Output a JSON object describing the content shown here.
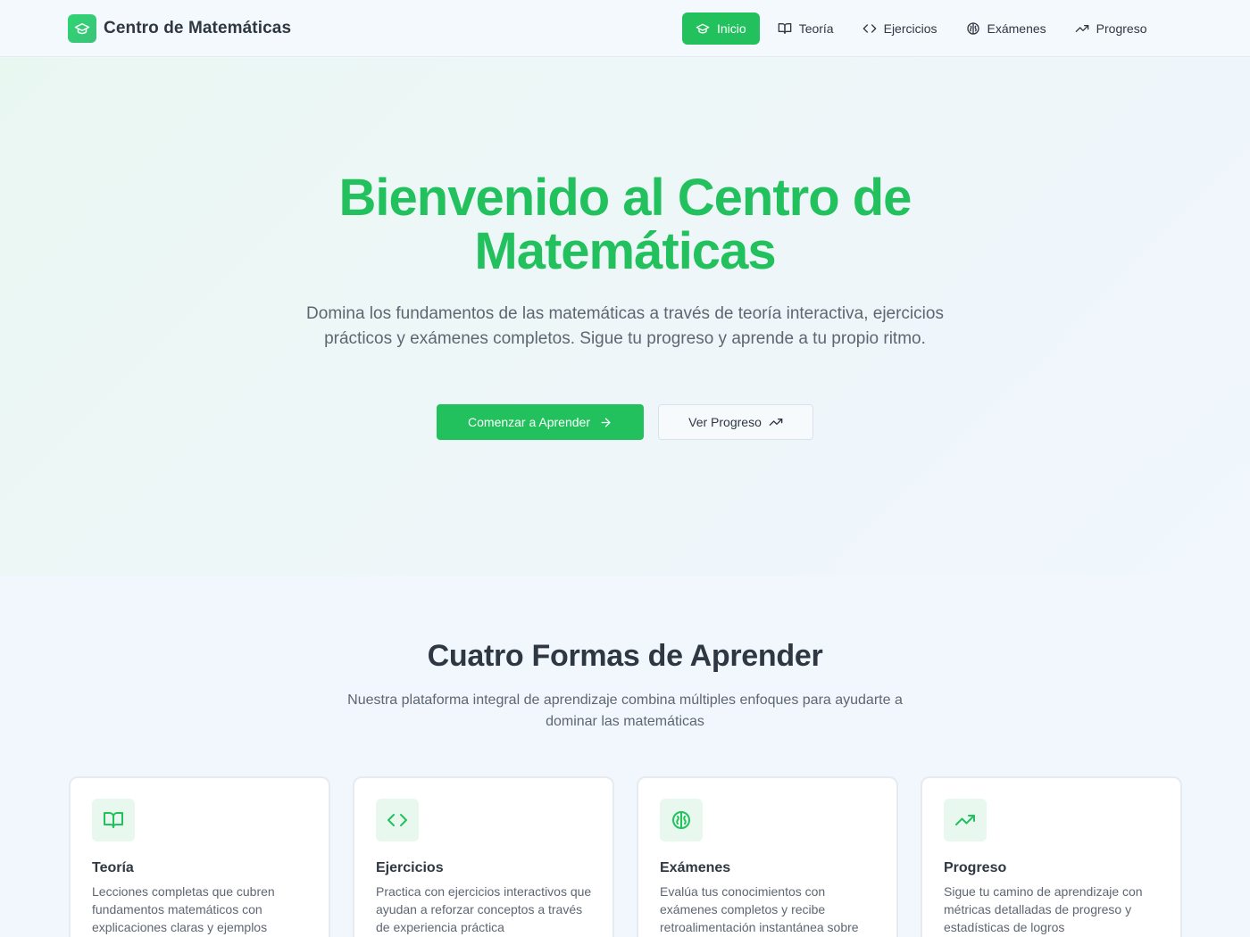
{
  "header": {
    "brand": "Centro de Matemáticas",
    "nav": [
      {
        "label": "Inicio",
        "icon": "graduation-cap-icon",
        "active": true
      },
      {
        "label": "Teoría",
        "icon": "book-open-icon",
        "active": false
      },
      {
        "label": "Ejercicios",
        "icon": "code-icon",
        "active": false
      },
      {
        "label": "Exámenes",
        "icon": "brain-icon",
        "active": false
      },
      {
        "label": "Progreso",
        "icon": "trending-up-icon",
        "active": false
      }
    ]
  },
  "hero": {
    "title_line1": "Bienvenido al Centro de",
    "title_line2": "Matemáticas",
    "description": "Domina los fundamentos de las matemáticas a través de teoría interactiva, ejercicios prácticos y exámenes completos. Sigue tu progreso y aprende a tu propio ritmo.",
    "primary_button": "Comenzar a Aprender",
    "secondary_button": "Ver Progreso"
  },
  "features": {
    "title": "Cuatro Formas de Aprender",
    "description": "Nuestra plataforma integral de aprendizaje combina múltiples enfoques para ayudarte a dominar las matemáticas",
    "cards": [
      {
        "title": "Teoría",
        "description": "Lecciones completas que cubren fundamentos matemáticos con explicaciones claras y ejemplos",
        "icon": "book-open-icon"
      },
      {
        "title": "Ejercicios",
        "description": "Practica con ejercicios interactivos que ayudan a reforzar conceptos a través de experiencia práctica",
        "icon": "code-icon"
      },
      {
        "title": "Exámenes",
        "description": "Evalúa tus conocimientos con exámenes completos y recibe retroalimentación instantánea sobre",
        "icon": "brain-icon"
      },
      {
        "title": "Progreso",
        "description": "Sigue tu camino de aprendizaje con métricas detalladas de progreso y estadísticas de logros",
        "icon": "trending-up-icon"
      }
    ]
  },
  "colors": {
    "accent": "#22c15e",
    "text": "#2e3742",
    "muted": "#5e6672",
    "background": "#f1f7fc"
  }
}
